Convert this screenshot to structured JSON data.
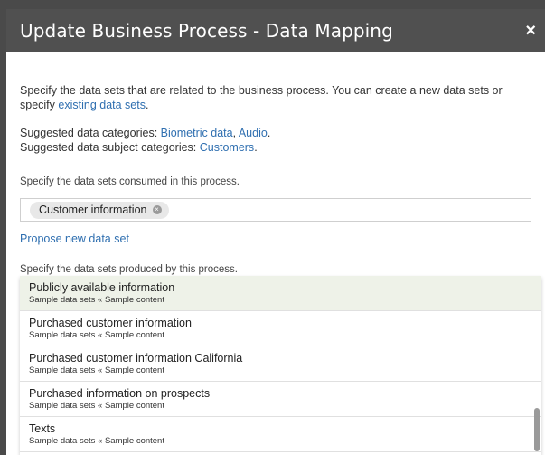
{
  "dialog": {
    "title": "Update Business Process - Data Mapping",
    "close_glyph": "×"
  },
  "intro": {
    "text_before": "Specify the data sets that are related to the business process. You can create a new data sets or specify ",
    "link": "existing data sets",
    "text_after": "."
  },
  "suggested": {
    "categories_label": "Suggested data categories: ",
    "categories": [
      "Biometric data",
      "Audio"
    ],
    "separator": ", ",
    "subject_label": "Suggested data subject categories: ",
    "subject": "Customers",
    "period": "."
  },
  "consumed": {
    "hint": "Specify the data sets consumed in this process.",
    "chip_label": "Customer information",
    "chip_remove": "×"
  },
  "propose_link": "Propose new data set",
  "produced": {
    "hint": "Specify the data sets produced by this process.",
    "value": ""
  },
  "dropdown": {
    "options": [
      {
        "title": "Publicly available information",
        "sub": "Sample data sets « Sample content"
      },
      {
        "title": "Purchased customer information",
        "sub": "Sample data sets « Sample content"
      },
      {
        "title": "Purchased customer information California",
        "sub": "Sample data sets « Sample content"
      },
      {
        "title": "Purchased information on prospects",
        "sub": "Sample data sets « Sample content"
      },
      {
        "title": "Texts",
        "sub": "Sample data sets « Sample content"
      }
    ]
  },
  "colors": {
    "titlebar": "#505050",
    "link": "#2f6fb0",
    "focus_border": "#6aa84f",
    "highlight": "#eef2e8"
  }
}
